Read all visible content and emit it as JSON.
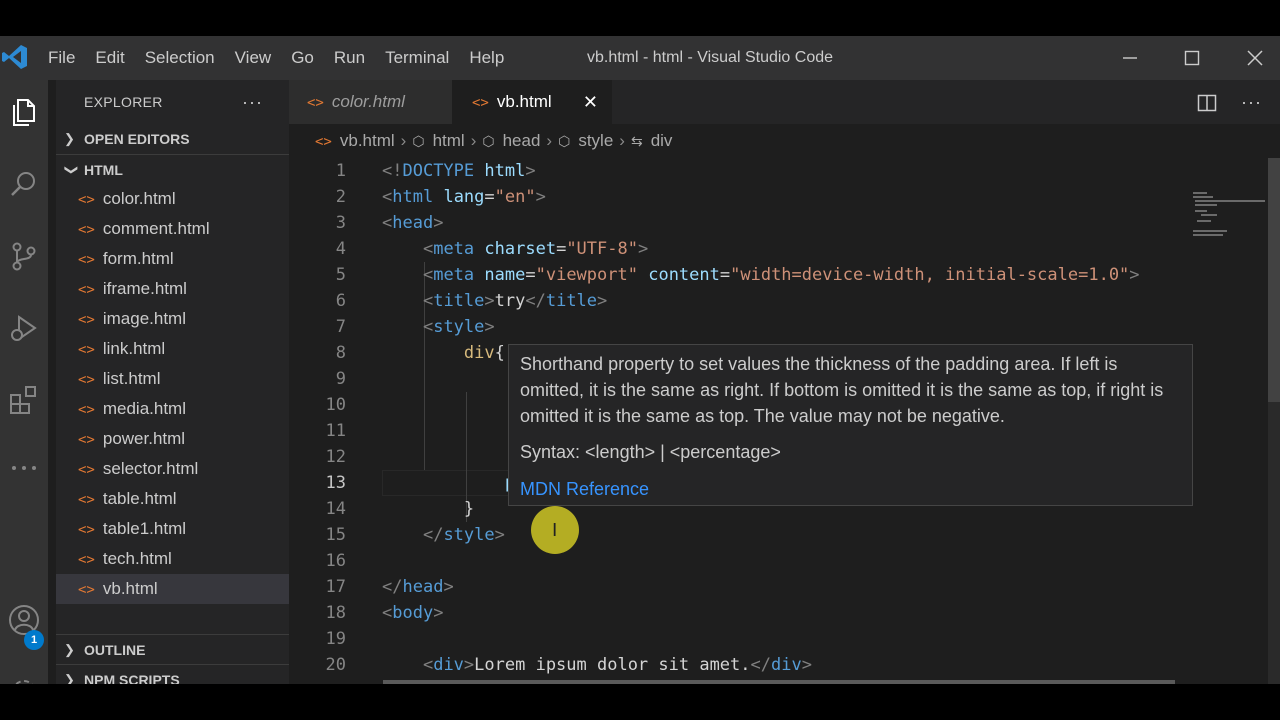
{
  "titlebar": {
    "menu": [
      "File",
      "Edit",
      "Selection",
      "View",
      "Go",
      "Run",
      "Terminal",
      "Help"
    ],
    "title": "vb.html - html - Visual Studio Code"
  },
  "activity_bar": {
    "items": [
      "files-icon",
      "search-icon",
      "source-control-icon",
      "run-debug-icon",
      "extensions-icon",
      "more-icon",
      "account-icon",
      "settings-gear-icon"
    ],
    "account_badge": "1"
  },
  "sidebar": {
    "title": "EXPLORER",
    "more": "···",
    "open_editors": "OPEN EDITORS",
    "folder": "HTML",
    "files": [
      "color.html",
      "comment.html",
      "form.html",
      "iframe.html",
      "image.html",
      "link.html",
      "list.html",
      "media.html",
      "power.html",
      "selector.html",
      "table.html",
      "table1.html",
      "tech.html",
      "vb.html"
    ],
    "active_file": "vb.html",
    "outline": "OUTLINE",
    "npm_scripts": "NPM SCRIPTS"
  },
  "tabs": [
    {
      "label": "color.html",
      "active": false
    },
    {
      "label": "vb.html",
      "active": true
    }
  ],
  "breadcrumb": [
    "vb.html",
    "html",
    "head",
    "style",
    "div"
  ],
  "editor": {
    "line_numbers": [
      "1",
      "2",
      "3",
      "4",
      "5",
      "6",
      "7",
      "8",
      "9",
      "10",
      "11",
      "12",
      "13",
      "14",
      "15",
      "16",
      "17",
      "18",
      "19",
      "20"
    ],
    "current_line": 13
  },
  "hover": {
    "description": "Shorthand property to set values the thickness of the padding area. If left is omitted, it is the same as right. If bottom is omitted it is the same as top, if right is omitted it is the same as top. The value may not be negative.",
    "syntax": "Syntax: <length> | <percentage>",
    "link": "MDN Reference"
  },
  "colors": {
    "accent": "#007acc",
    "html_icon": "#e37933",
    "link": "#3794ff"
  }
}
